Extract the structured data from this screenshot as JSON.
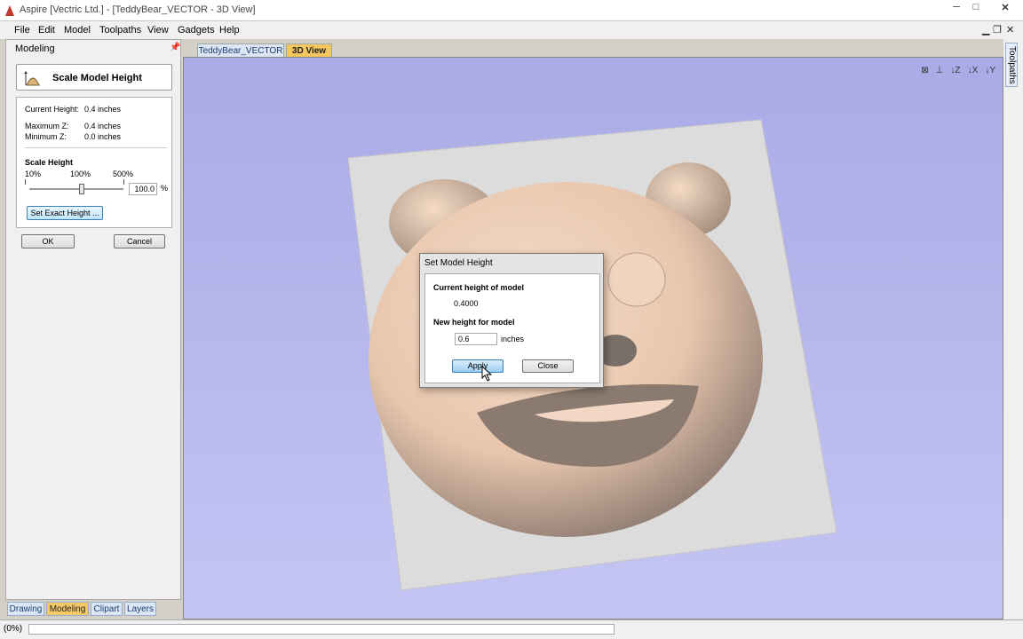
{
  "window": {
    "title": "Aspire [Vectric Ltd.] - [TeddyBear_VECTOR - 3D View]",
    "minimize": "─",
    "maximize": "□",
    "close": "✕"
  },
  "menu": [
    "File",
    "Edit",
    "Model",
    "Toolpaths",
    "View",
    "Gadgets",
    "Help"
  ],
  "mdi_controls": {
    "minimize": "▁",
    "restore": "❐",
    "close": "✕"
  },
  "left_panel": {
    "title": "Modeling",
    "tool_title": "Scale Model Height",
    "current_height_label": "Current Height:",
    "current_height_value": "0.4 inches",
    "max_z_label": "Maximum Z:",
    "max_z_value": "0.4 inches",
    "min_z_label": "Minimum Z:",
    "min_z_value": "0.0 inches",
    "scale_height_title": "Scale Height",
    "ticks": [
      "10%",
      "100%",
      "500%"
    ],
    "percent_value": "100.0",
    "percent_sign": "%",
    "exact_height_button": "Set Exact Height ...",
    "ok_button": "OK",
    "cancel_button": "Cancel"
  },
  "bottom_tabs": [
    {
      "label": "Drawing",
      "active": false
    },
    {
      "label": "Modeling",
      "active": true
    },
    {
      "label": "Clipart",
      "active": false
    },
    {
      "label": "Layers",
      "active": false
    }
  ],
  "doc_tabs": [
    {
      "label": "TeddyBear_VECTOR",
      "active": false
    },
    {
      "label": "3D View",
      "active": true
    }
  ],
  "right_strip": {
    "toolpaths_tab": "Toolpaths"
  },
  "status": {
    "text": "(0%)",
    "progress": 0.0
  },
  "dialog": {
    "title": "Set Model Height",
    "current_label": "Current height of model",
    "current_value": "0.4000",
    "new_label": "New height for model",
    "new_value": "0.6",
    "unit": "inches",
    "apply_button": "Apply",
    "close_button": "Close"
  },
  "colors": {
    "view_background": "#b8b8f0",
    "model_color": "#eed0b8",
    "plate_color": "#d8d8d8",
    "active_tab": "#f5c65c"
  }
}
